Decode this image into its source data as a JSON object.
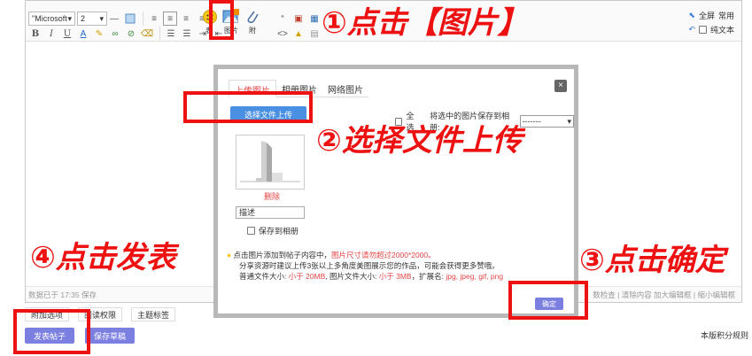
{
  "toolbar": {
    "font_name": "\"Microsoft",
    "font_size": "2",
    "table_label": "表",
    "image_label": "图片",
    "attach_label": "附",
    "fullscreen_label": "全屏",
    "common_label": "常用",
    "plaintext_label": "纯文本"
  },
  "editor": {
    "autosave": "数据已于 17:35 保存",
    "tools": "数检查 | 清除内容   加大编辑框 | 缩小编辑框"
  },
  "options": {
    "attach": "附加选项",
    "read_perm": "阅读权限",
    "topic_tag": "主题标签"
  },
  "actions": {
    "post": "发表帖子",
    "save_draft": "保存草稿",
    "rules": "本版积分规则"
  },
  "dialog": {
    "tabs": [
      "上传图片",
      "相册图片",
      "网络图片"
    ],
    "close": "×",
    "upload_button": "选择文件上传",
    "select_all": "全选",
    "save_selected": "将选中的图片保存到相册:",
    "album_value": "-------",
    "delete": "删除",
    "desc_value": "描述",
    "save_to_album": "保存到相册",
    "tip1_a": "点击图片添加到帖子内容中，",
    "tip1_b": "图片尺寸请勿超过2000*2000。",
    "tip2": "分享资源时建议上传3张以上多角度美图展示您的作品，可能会获得更多赞哦。",
    "tip3_a": "普通文件大小: ",
    "tip3_b": "小于 20MB",
    "tip3_c": ", 图片文件大小: ",
    "tip3_d": "小于 3MB",
    "tip3_e": "，扩展名: ",
    "tip3_f": "jpg, jpeg, gif, png",
    "confirm": "确定"
  },
  "annotations": {
    "step1": "①点击【图片】",
    "step2": "②选择文件上传",
    "step3": "③点击确定",
    "step4": "④点击发表"
  },
  "colors": {
    "annotation_red": "#ee1111",
    "accent_red": "#e64545",
    "button_purple": "#7b7fe0",
    "button_blue": "#4a90e2"
  }
}
